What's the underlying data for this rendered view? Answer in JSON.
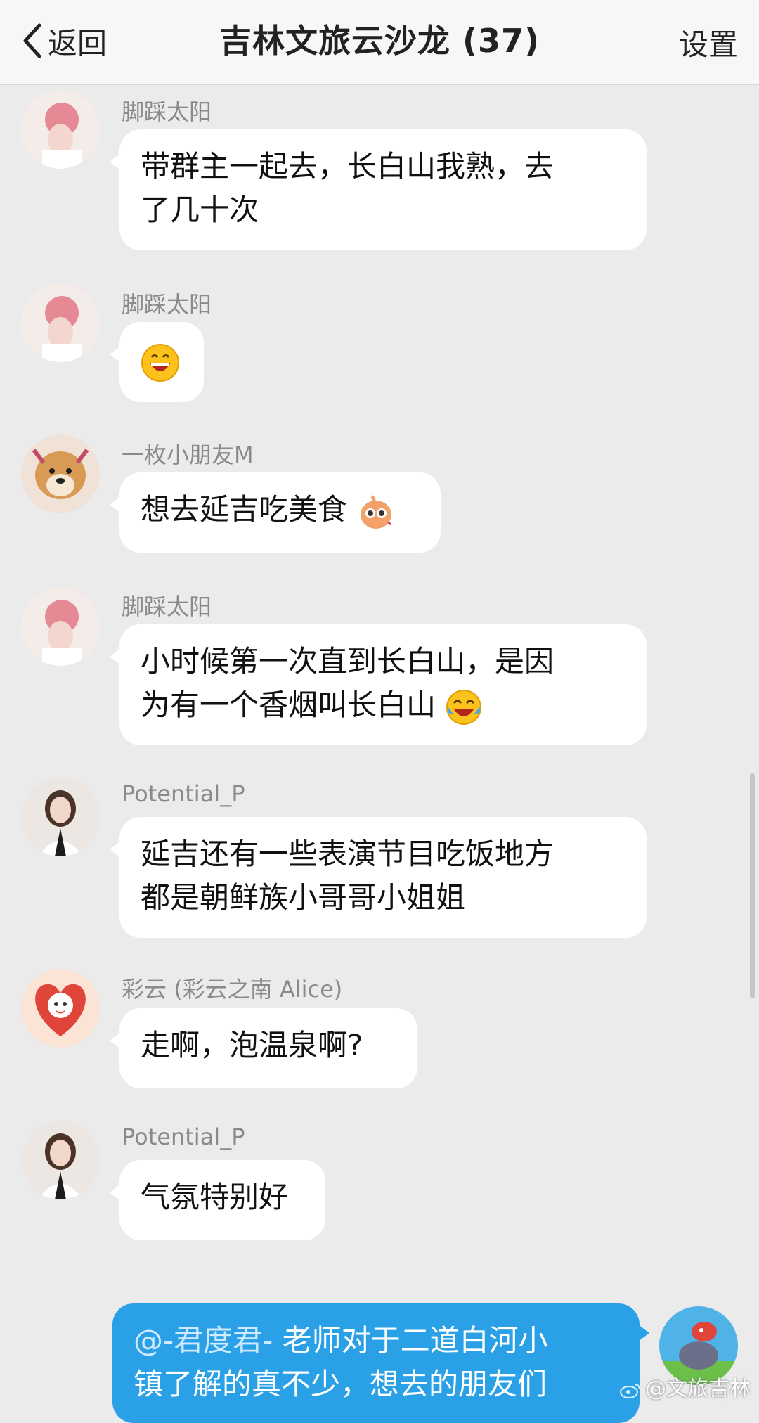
{
  "header": {
    "back_label": "返回",
    "title": "吉林文旅云沙龙 (37)",
    "settings_label": "设置"
  },
  "messages": [
    {
      "sender": "脚踩太阳",
      "text_lines": [
        "带群主一起去，长白山我熟，去",
        "了几十次"
      ]
    },
    {
      "sender": "脚踩太阳",
      "emoji": "grinning-emoji"
    },
    {
      "sender": "一枚小朋友M",
      "text_lines": [
        "想去延吉吃美食"
      ],
      "emoji": "cute-sticker-emoji"
    },
    {
      "sender": "脚踩太阳",
      "text_lines": [
        "小时候第一次直到长白山，是因",
        "为有一个香烟叫长白山"
      ],
      "emoji": "tears-of-joy-emoji"
    },
    {
      "sender": "Potential_P",
      "text_lines": [
        "延吉还有一些表演节目吃饭地方",
        "都是朝鲜族小哥哥小姐姐"
      ]
    },
    {
      "sender": "彩云 (彩云之南 Alice)",
      "text_lines": [
        "走啊，泡温泉啊?"
      ]
    },
    {
      "sender": "Potential_P",
      "text_lines": [
        "气氛特别好"
      ]
    },
    {
      "self": true,
      "mention": "@-君度君-",
      "text_line1_rest": " 老师对于二道白河小",
      "text_line2": "镇了解的真不少，想去的朋友们"
    }
  ],
  "watermark": "@文旅吉林",
  "colors": {
    "self_bubble": "#2aa0e6",
    "background": "#ebebeb"
  }
}
